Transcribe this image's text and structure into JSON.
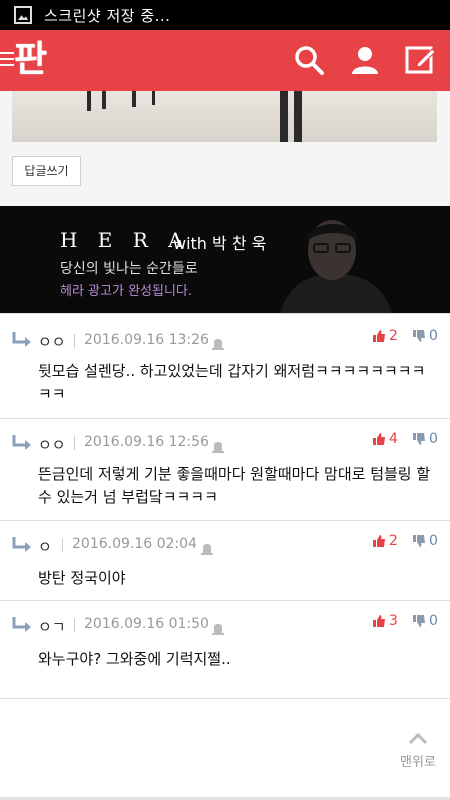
{
  "status_bar": {
    "text": "스크린샷 저장 중..."
  },
  "app_bar": {
    "logo": "판"
  },
  "post": {
    "reply_button": "답글쓰기"
  },
  "ad": {
    "brand": "H E R A",
    "with": "with 박 찬 욱",
    "line1": "당신의 빛나는 순간들로",
    "line2": "헤라 광고가 완성됩니다."
  },
  "comments": [
    {
      "nick": "ㅇㅇ",
      "date": "2016.09.16 13:26",
      "likes": "2",
      "dislikes": "0",
      "text": "뒷모습 설렌당.. 하고있었는데 갑자기 왜저럼ㅋㅋㅋㅋㅋㅋㅋㅋㅋㅋ"
    },
    {
      "nick": "ㅇㅇ",
      "date": "2016.09.16 12:56",
      "likes": "4",
      "dislikes": "0",
      "text": "뜬금인데 저렇게 기분 좋을때마다 원할때마다 맘대로 텀블링 할수 있는거 넘 부럽닼ㅋㅋㅋㅋ"
    },
    {
      "nick": "ㅇ",
      "date": "2016.09.16 02:04",
      "likes": "2",
      "dislikes": "0",
      "text": "방탄 정국이야"
    },
    {
      "nick": "ㅇㄱ",
      "date": "2016.09.16 01:50",
      "likes": "3",
      "dislikes": "0",
      "text": "와누구야? 그와중에 기럭지쩔.."
    }
  ],
  "scroll_top": {
    "label": "맨위로"
  },
  "colors": {
    "brand": "#e74245",
    "like": "#e74245",
    "dislike": "#6c87a6",
    "ad_accent": "#b98ad8"
  }
}
